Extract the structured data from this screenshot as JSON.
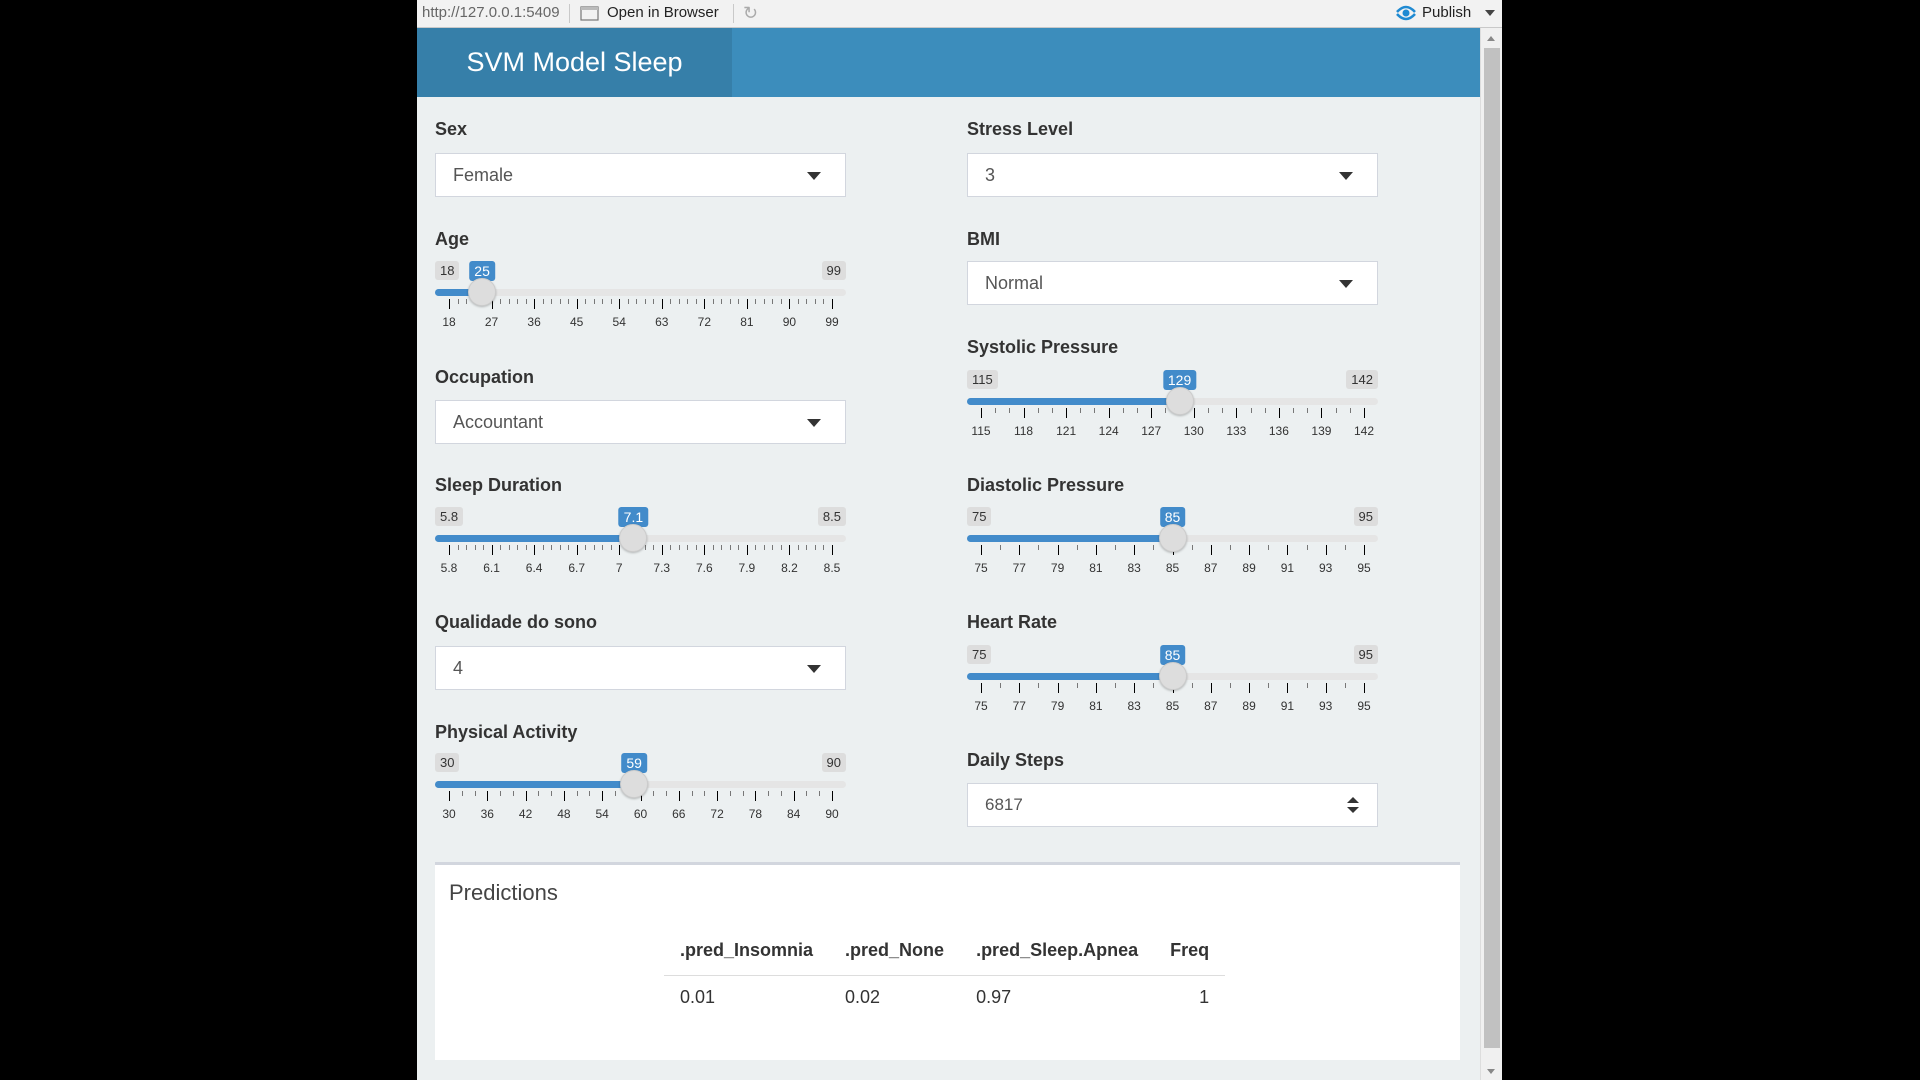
{
  "toolbar": {
    "url": "http://127.0.0.1:5409",
    "open_label": "Open in Browser",
    "publish_label": "Publish"
  },
  "header": {
    "title": "SVM Model Sleep"
  },
  "inputs": {
    "sex": {
      "label": "Sex",
      "value": "Female"
    },
    "age": {
      "label": "Age",
      "min": 18,
      "max": 99,
      "value": 25,
      "ticks": [
        "18",
        "27",
        "36",
        "45",
        "54",
        "63",
        "72",
        "81",
        "90",
        "99"
      ],
      "minor_per_major": 4
    },
    "occupation": {
      "label": "Occupation",
      "value": "Accountant"
    },
    "sleep_duration": {
      "label": "Sleep Duration",
      "min": 5.8,
      "max": 8.5,
      "value": 7.1,
      "ticks": [
        "5.8",
        "6.1",
        "6.4",
        "6.7",
        "7",
        "7.3",
        "7.6",
        "7.9",
        "8.2",
        "8.5"
      ],
      "minor_per_major": 4
    },
    "sleep_quality": {
      "label": "Qualidade do sono",
      "value": "4"
    },
    "physical_activity": {
      "label": "Physical Activity",
      "min": 30,
      "max": 90,
      "value": 59,
      "ticks": [
        "30",
        "36",
        "42",
        "48",
        "54",
        "60",
        "66",
        "72",
        "78",
        "84",
        "90"
      ],
      "minor_per_major": 2
    },
    "stress_level": {
      "label": "Stress Level",
      "value": "3"
    },
    "bmi": {
      "label": "BMI",
      "value": "Normal"
    },
    "systolic": {
      "label": "Systolic Pressure",
      "min": 115,
      "max": 142,
      "value": 129,
      "ticks": [
        "115",
        "118",
        "121",
        "124",
        "127",
        "130",
        "133",
        "136",
        "139",
        "142"
      ],
      "minor_per_major": 2
    },
    "diastolic": {
      "label": "Diastolic Pressure",
      "min": 75,
      "max": 95,
      "value": 85,
      "ticks": [
        "75",
        "77",
        "79",
        "81",
        "83",
        "85",
        "87",
        "89",
        "91",
        "93",
        "95"
      ],
      "minor_per_major": 1
    },
    "heart_rate": {
      "label": "Heart Rate",
      "min": 75,
      "max": 95,
      "value": 85,
      "ticks": [
        "75",
        "77",
        "79",
        "81",
        "83",
        "85",
        "87",
        "89",
        "91",
        "93",
        "95"
      ],
      "minor_per_major": 1
    },
    "daily_steps": {
      "label": "Daily Steps",
      "value": "6817"
    }
  },
  "predictions": {
    "title": "Predictions",
    "columns": [
      ".pred_Insomnia",
      ".pred_None",
      ".pred_Sleep.Apnea",
      "Freq"
    ],
    "rows": [
      [
        "0.01",
        "0.02",
        "0.97",
        "1"
      ]
    ]
  }
}
